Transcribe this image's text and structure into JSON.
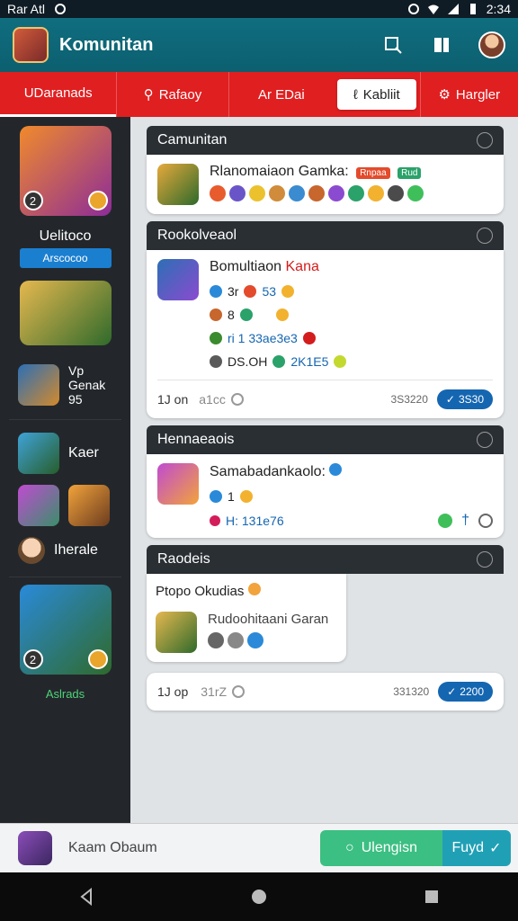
{
  "status_bar": {
    "left_text": "Rar Atl",
    "time": "2:34"
  },
  "app_bar": {
    "title": "Komunitan"
  },
  "tabs": [
    {
      "label": "UDaranads"
    },
    {
      "label": "Rafaoy"
    },
    {
      "label": "Ar EDai"
    },
    {
      "label": "Kabliit"
    },
    {
      "label": "Hargler"
    }
  ],
  "sidebar": {
    "card1": {
      "label": "Uelitoco",
      "pill": "Arscocoo",
      "badge": "2"
    },
    "row_vp": {
      "line1": "Vp",
      "line2": "Genak",
      "line3": "95"
    },
    "row_kaer": {
      "label": "Kaer"
    },
    "row_iherale": {
      "label": "Iherale"
    },
    "card3_badge": "2",
    "footer": "Aslrads"
  },
  "main": {
    "section1": {
      "header": "Camunitan",
      "title": "Rlanomaiaon Gamka:",
      "tag1": "Rnpaa",
      "tag2": "Rud"
    },
    "section2": {
      "header": "Rookolveaol",
      "title": "Bomultiaon",
      "title_red": "Kana",
      "line1": "3r",
      "line1b": "53",
      "line2": "8",
      "line3": "ri 1 33ae3e3",
      "line4a": "DS.OH",
      "line4b": "2K1E5",
      "footer_left": "1J on",
      "footer_mid": "a1cc",
      "footer_num": "3S3220",
      "footer_btn": "3S30"
    },
    "section3": {
      "header": "Hennaeaois",
      "title": "Samabadankaolo:",
      "line1": "1",
      "line2": "H: 131e76"
    },
    "section4": {
      "header": "Raodeis",
      "card_title": "Ptopo Okudias",
      "item_title": "Rudoohitaani Garan"
    },
    "bottom_card": {
      "left": "1J op",
      "mid": "31rZ",
      "num": "331320",
      "btn": "2200"
    }
  },
  "bottom_bar": {
    "text": "Kaam Obaum",
    "btn_left": "Ulengisn",
    "btn_right": "Fuyd"
  },
  "colors": {
    "accent_red": "#e01f21",
    "app_bar_teal": "#0f6e7f",
    "button_blue": "#1566b1",
    "green": "#3cbf82"
  }
}
